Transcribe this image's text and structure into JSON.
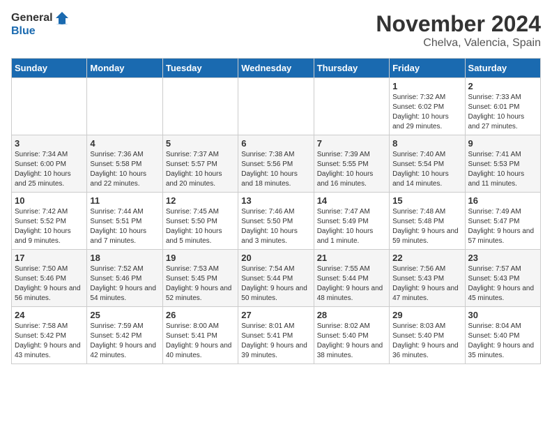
{
  "header": {
    "logo_general": "General",
    "logo_blue": "Blue",
    "month": "November 2024",
    "location": "Chelva, Valencia, Spain"
  },
  "days_of_week": [
    "Sunday",
    "Monday",
    "Tuesday",
    "Wednesday",
    "Thursday",
    "Friday",
    "Saturday"
  ],
  "weeks": [
    [
      {
        "day": "",
        "info": ""
      },
      {
        "day": "",
        "info": ""
      },
      {
        "day": "",
        "info": ""
      },
      {
        "day": "",
        "info": ""
      },
      {
        "day": "",
        "info": ""
      },
      {
        "day": "1",
        "info": "Sunrise: 7:32 AM\nSunset: 6:02 PM\nDaylight: 10 hours and 29 minutes."
      },
      {
        "day": "2",
        "info": "Sunrise: 7:33 AM\nSunset: 6:01 PM\nDaylight: 10 hours and 27 minutes."
      }
    ],
    [
      {
        "day": "3",
        "info": "Sunrise: 7:34 AM\nSunset: 6:00 PM\nDaylight: 10 hours and 25 minutes."
      },
      {
        "day": "4",
        "info": "Sunrise: 7:36 AM\nSunset: 5:58 PM\nDaylight: 10 hours and 22 minutes."
      },
      {
        "day": "5",
        "info": "Sunrise: 7:37 AM\nSunset: 5:57 PM\nDaylight: 10 hours and 20 minutes."
      },
      {
        "day": "6",
        "info": "Sunrise: 7:38 AM\nSunset: 5:56 PM\nDaylight: 10 hours and 18 minutes."
      },
      {
        "day": "7",
        "info": "Sunrise: 7:39 AM\nSunset: 5:55 PM\nDaylight: 10 hours and 16 minutes."
      },
      {
        "day": "8",
        "info": "Sunrise: 7:40 AM\nSunset: 5:54 PM\nDaylight: 10 hours and 14 minutes."
      },
      {
        "day": "9",
        "info": "Sunrise: 7:41 AM\nSunset: 5:53 PM\nDaylight: 10 hours and 11 minutes."
      }
    ],
    [
      {
        "day": "10",
        "info": "Sunrise: 7:42 AM\nSunset: 5:52 PM\nDaylight: 10 hours and 9 minutes."
      },
      {
        "day": "11",
        "info": "Sunrise: 7:44 AM\nSunset: 5:51 PM\nDaylight: 10 hours and 7 minutes."
      },
      {
        "day": "12",
        "info": "Sunrise: 7:45 AM\nSunset: 5:50 PM\nDaylight: 10 hours and 5 minutes."
      },
      {
        "day": "13",
        "info": "Sunrise: 7:46 AM\nSunset: 5:50 PM\nDaylight: 10 hours and 3 minutes."
      },
      {
        "day": "14",
        "info": "Sunrise: 7:47 AM\nSunset: 5:49 PM\nDaylight: 10 hours and 1 minute."
      },
      {
        "day": "15",
        "info": "Sunrise: 7:48 AM\nSunset: 5:48 PM\nDaylight: 9 hours and 59 minutes."
      },
      {
        "day": "16",
        "info": "Sunrise: 7:49 AM\nSunset: 5:47 PM\nDaylight: 9 hours and 57 minutes."
      }
    ],
    [
      {
        "day": "17",
        "info": "Sunrise: 7:50 AM\nSunset: 5:46 PM\nDaylight: 9 hours and 56 minutes."
      },
      {
        "day": "18",
        "info": "Sunrise: 7:52 AM\nSunset: 5:46 PM\nDaylight: 9 hours and 54 minutes."
      },
      {
        "day": "19",
        "info": "Sunrise: 7:53 AM\nSunset: 5:45 PM\nDaylight: 9 hours and 52 minutes."
      },
      {
        "day": "20",
        "info": "Sunrise: 7:54 AM\nSunset: 5:44 PM\nDaylight: 9 hours and 50 minutes."
      },
      {
        "day": "21",
        "info": "Sunrise: 7:55 AM\nSunset: 5:44 PM\nDaylight: 9 hours and 48 minutes."
      },
      {
        "day": "22",
        "info": "Sunrise: 7:56 AM\nSunset: 5:43 PM\nDaylight: 9 hours and 47 minutes."
      },
      {
        "day": "23",
        "info": "Sunrise: 7:57 AM\nSunset: 5:43 PM\nDaylight: 9 hours and 45 minutes."
      }
    ],
    [
      {
        "day": "24",
        "info": "Sunrise: 7:58 AM\nSunset: 5:42 PM\nDaylight: 9 hours and 43 minutes."
      },
      {
        "day": "25",
        "info": "Sunrise: 7:59 AM\nSunset: 5:42 PM\nDaylight: 9 hours and 42 minutes."
      },
      {
        "day": "26",
        "info": "Sunrise: 8:00 AM\nSunset: 5:41 PM\nDaylight: 9 hours and 40 minutes."
      },
      {
        "day": "27",
        "info": "Sunrise: 8:01 AM\nSunset: 5:41 PM\nDaylight: 9 hours and 39 minutes."
      },
      {
        "day": "28",
        "info": "Sunrise: 8:02 AM\nSunset: 5:40 PM\nDaylight: 9 hours and 38 minutes."
      },
      {
        "day": "29",
        "info": "Sunrise: 8:03 AM\nSunset: 5:40 PM\nDaylight: 9 hours and 36 minutes."
      },
      {
        "day": "30",
        "info": "Sunrise: 8:04 AM\nSunset: 5:40 PM\nDaylight: 9 hours and 35 minutes."
      }
    ]
  ]
}
